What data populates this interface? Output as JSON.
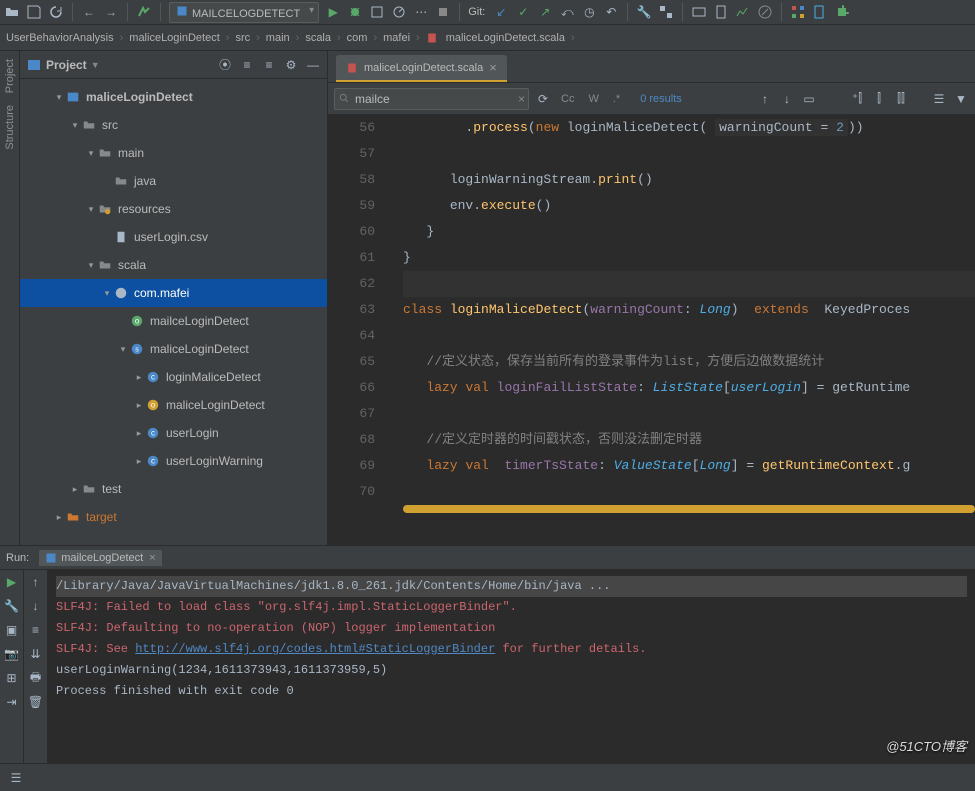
{
  "toolbar": {
    "run_config": "MAILCELOGDETECT",
    "git_label": "Git:"
  },
  "breadcrumb": [
    "UserBehaviorAnalysis",
    "maliceLoginDetect",
    "src",
    "main",
    "scala",
    "com",
    "mafei",
    "maliceLoginDetect.scala"
  ],
  "project_panel": {
    "title": "Project"
  },
  "tree": [
    {
      "d": 2,
      "tw": "▾",
      "icon": "module",
      "label": "maliceLoginDetect",
      "bold": true
    },
    {
      "d": 3,
      "tw": "▾",
      "icon": "folder",
      "label": "src"
    },
    {
      "d": 4,
      "tw": "▾",
      "icon": "folder",
      "label": "main"
    },
    {
      "d": 5,
      "tw": "",
      "icon": "folder",
      "label": "java"
    },
    {
      "d": 4,
      "tw": "▾",
      "icon": "res",
      "label": "resources"
    },
    {
      "d": 5,
      "tw": "",
      "icon": "file",
      "label": "userLogin.csv"
    },
    {
      "d": 4,
      "tw": "▾",
      "icon": "folder",
      "label": "scala"
    },
    {
      "d": 5,
      "tw": "▾",
      "icon": "pkg",
      "label": "com.mafei",
      "sel": true
    },
    {
      "d": 6,
      "tw": "",
      "icon": "obj",
      "label": "mailceLoginDetect"
    },
    {
      "d": 6,
      "tw": "▾",
      "icon": "scala",
      "label": "maliceLoginDetect"
    },
    {
      "d": 7,
      "tw": "▸",
      "icon": "cls",
      "label": "loginMaliceDetect"
    },
    {
      "d": 7,
      "tw": "▸",
      "icon": "obj2",
      "label": "maliceLoginDetect"
    },
    {
      "d": 7,
      "tw": "▸",
      "icon": "cls",
      "label": "userLogin"
    },
    {
      "d": 7,
      "tw": "▸",
      "icon": "cls",
      "label": "userLoginWarning"
    },
    {
      "d": 3,
      "tw": "▸",
      "icon": "folder",
      "label": "test"
    },
    {
      "d": 2,
      "tw": "▸",
      "icon": "target",
      "label": "target",
      "orange": true
    }
  ],
  "editor": {
    "tab_label": "maliceLoginDetect.scala",
    "search_value": "mailce",
    "results_label": "0 results"
  },
  "code_lines": [
    {
      "n": 56,
      "html": "        .<span class='fn'>process</span><span class='plain'>(</span><span class='kw'>new</span> <span class='plain'>loginMaliceDetect(</span> <span class='param plain'>warningCount = <span class='num'>2</span></span><span class='plain'>))</span>"
    },
    {
      "n": 57,
      "html": ""
    },
    {
      "n": 58,
      "html": "      <span class='plain'>loginWarningStream</span><span class='plain'>.</span><span class='fn'>print</span><span class='plain'>()</span>"
    },
    {
      "n": 59,
      "html": "      <span class='plain'>env</span><span class='plain'>.</span><span class='fn'>execute</span><span class='plain'>()</span>"
    },
    {
      "n": 60,
      "html": "   <span class='plain'>}</span>"
    },
    {
      "n": 61,
      "html": "<span class='plain'>}</span>"
    },
    {
      "n": 62,
      "html": "",
      "caret": true
    },
    {
      "n": 63,
      "html": "<span class='kw'>class</span> <span class='fn'>loginMaliceDetect</span><span class='plain'>(</span><span class='ident'>warningCount</span><span class='plain'>:</span> <span class='typ'>Long</span><span class='plain'>)</span>  <span class='kw'>extends</span>  <span class='plain'>KeyedProces</span>"
    },
    {
      "n": 64,
      "html": ""
    },
    {
      "n": 65,
      "html": "   <span class='cmt'>//定义状态，保存当前所有的登录事件为list，方便后边做数据统计</span>"
    },
    {
      "n": 66,
      "html": "   <span class='kw'>lazy</span> <span class='kw'>val</span> <span class='ident'>loginFailListState</span><span class='plain'>:</span> <span class='typ'>ListState</span><span class='plain'>[</span><span class='typ'>userLogin</span><span class='plain'>]</span> <span class='plain'>=</span> <span class='plain'>getRuntime</span>"
    },
    {
      "n": 67,
      "html": ""
    },
    {
      "n": 68,
      "html": "   <span class='cmt'>//定义定时器的时间戳状态，否则没法删定时器</span>"
    },
    {
      "n": 69,
      "html": "   <span class='kw'>lazy</span> <span class='kw'>val</span>  <span class='ident'>timerTsState</span><span class='plain'>:</span> <span class='typ'>ValueState</span><span class='plain'>[</span><span class='typ'>Long</span><span class='plain'>]</span> <span class='plain'>=</span> <span class='fn'>getRuntimeContext</span><span class='plain'>.</span><span class='plain'>g</span>"
    },
    {
      "n": 70,
      "html": ""
    }
  ],
  "run": {
    "title": "Run:",
    "tab": "mailceLogDetect",
    "lines": [
      {
        "cls": "cgrey cgreybg",
        "text": "/Library/Java/JavaVirtualMachines/jdk1.8.0_261.jdk/Contents/Home/bin/java ..."
      },
      {
        "cls": "cred",
        "text": "SLF4J: Failed to load class \"org.slf4j.impl.StaticLoggerBinder\"."
      },
      {
        "cls": "cred",
        "text": "SLF4J: Defaulting to no-operation (NOP) logger implementation"
      },
      {
        "cls": "cred",
        "html": "SLF4J: See <span class='clink'>http://www.slf4j.org/codes.html#StaticLoggerBinder</span> for further details."
      },
      {
        "cls": "cgrey",
        "text": "userLoginWarning(1234,1611373943,1611373959,5)"
      },
      {
        "cls": "",
        "text": ""
      },
      {
        "cls": "cgrey",
        "text": "Process finished with exit code 0"
      }
    ]
  },
  "watermark": "@51CTO博客"
}
